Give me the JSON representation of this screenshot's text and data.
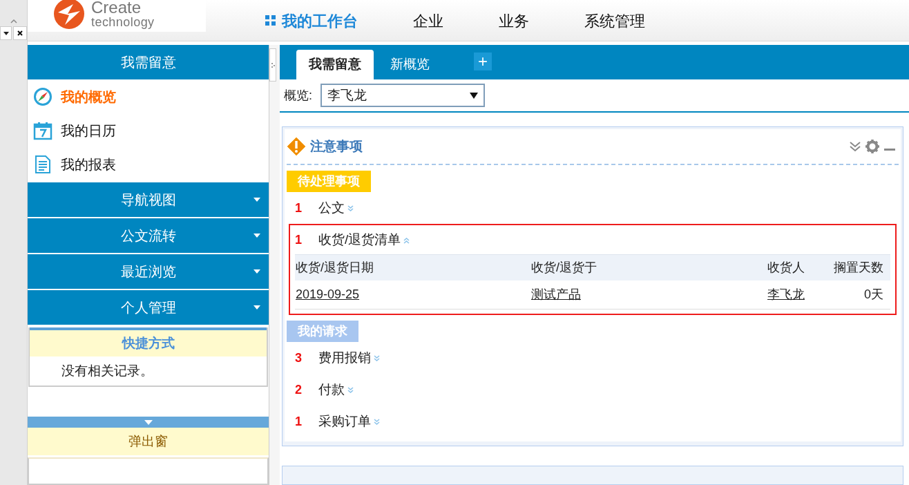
{
  "logo": {
    "title": "Create",
    "subtitle": "technology"
  },
  "nav": [
    {
      "label": "我的工作台",
      "selected": true
    },
    {
      "label": "企业",
      "selected": false
    },
    {
      "label": "业务",
      "selected": false
    },
    {
      "label": "系统管理",
      "selected": false
    }
  ],
  "sidebar": {
    "header": "我需留意",
    "items": [
      {
        "label": "我的概览",
        "selected": true,
        "kind": "compass"
      },
      {
        "label": "我的日历",
        "selected": false,
        "kind": "calendar"
      },
      {
        "label": "我的报表",
        "selected": false,
        "kind": "report"
      }
    ],
    "sections": [
      {
        "label": "导航视图"
      },
      {
        "label": "公文流转"
      },
      {
        "label": "最近浏览"
      },
      {
        "label": "个人管理"
      }
    ],
    "shortcuts": {
      "title": "快捷方式",
      "empty": "没有相关记录。"
    },
    "popup": {
      "title": "弹出窗"
    }
  },
  "tabs": [
    {
      "label": "我需留意",
      "selected": true
    },
    {
      "label": "新概览",
      "selected": false
    }
  ],
  "add_tab": "+",
  "overview": {
    "label": "概览:",
    "value": "李飞龙"
  },
  "panel": {
    "title": "注意事项",
    "groups": [
      {
        "title": "待处理事项",
        "kind": "pending",
        "items": [
          {
            "count": "1",
            "label": "公文",
            "expanded": false
          },
          {
            "count": "1",
            "label": "收货/退货清单",
            "expanded": true,
            "highlighted": true,
            "table": {
              "columns": [
                "收货/退货日期",
                "收货/退货于",
                "收货人",
                "搁置天数"
              ],
              "rows": [
                [
                  "2019-09-25",
                  "测试产品",
                  "李飞龙",
                  "0天"
                ]
              ]
            }
          }
        ]
      },
      {
        "title": "我的请求",
        "kind": "requests",
        "items": [
          {
            "count": "3",
            "label": "费用报销",
            "expanded": false
          },
          {
            "count": "2",
            "label": "付款",
            "expanded": false
          },
          {
            "count": "1",
            "label": "采购订单",
            "expanded": false
          }
        ]
      }
    ]
  }
}
